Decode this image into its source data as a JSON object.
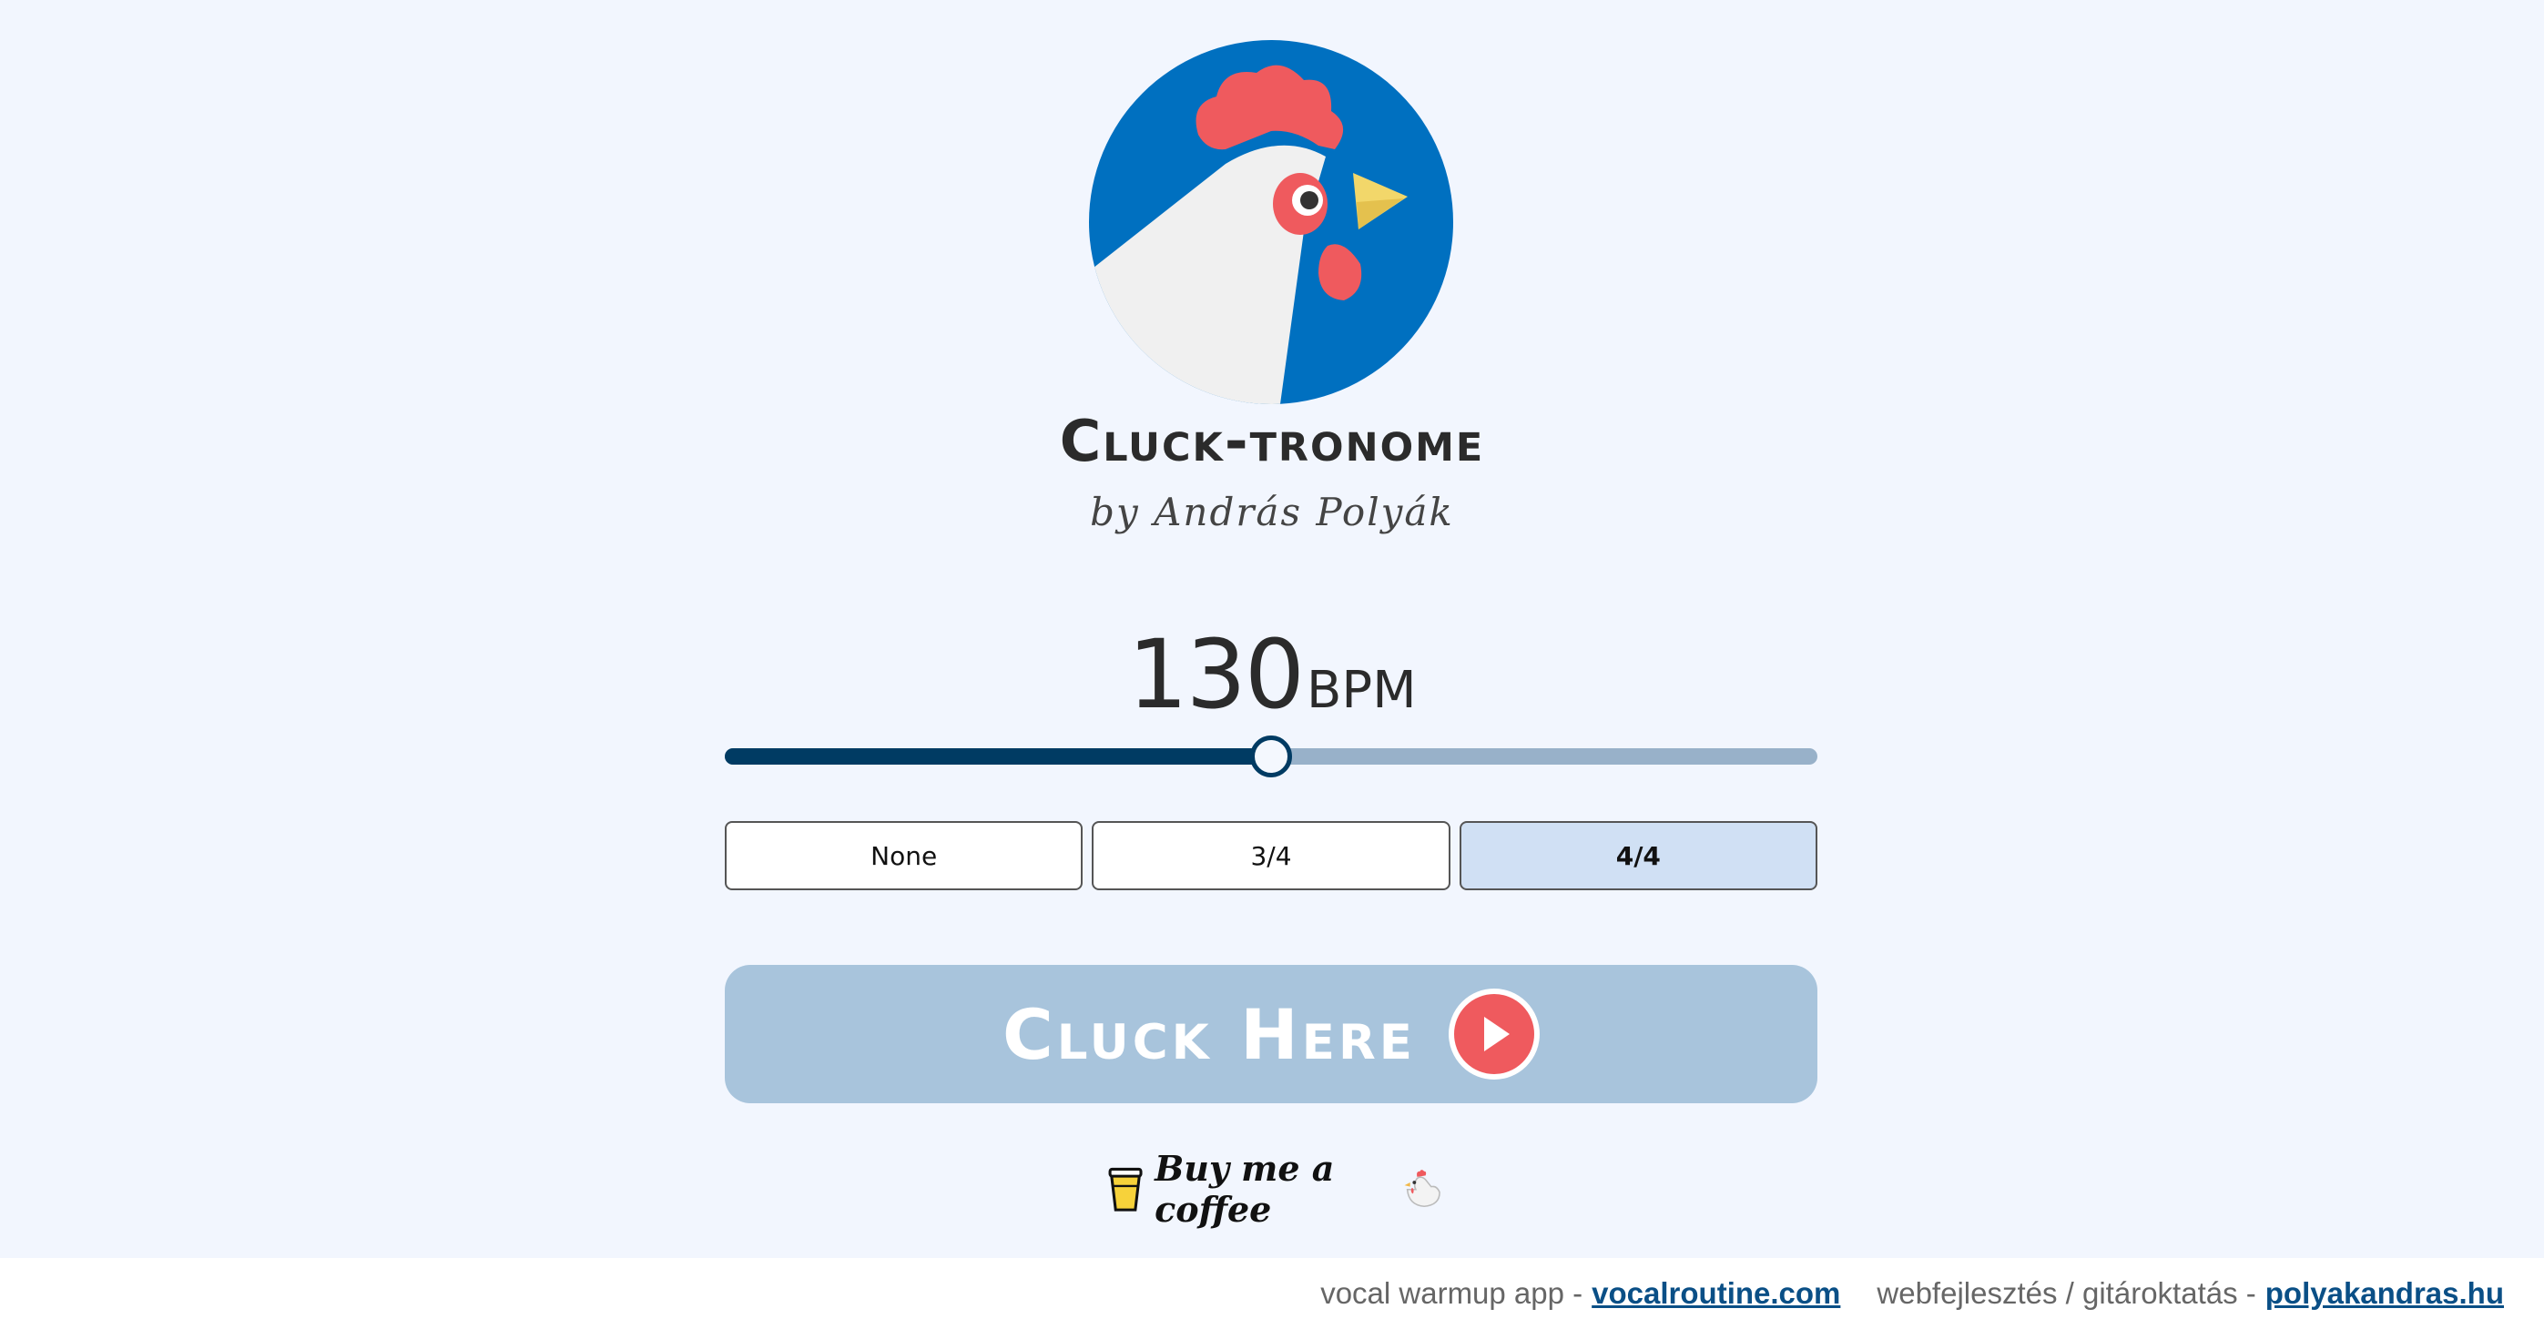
{
  "app": {
    "title": "Cluck-tronome",
    "subtitle": "by András Polyák"
  },
  "tempo": {
    "value": "130",
    "unit": "BPM",
    "slider_fraction": 0.5
  },
  "time_signatures": {
    "options": [
      "None",
      "3/4",
      "4/4"
    ],
    "selected": "4/4"
  },
  "cluck_button": {
    "label": "Cluck Here"
  },
  "coffee": {
    "label": "Buy me a coffee"
  },
  "footer": {
    "item1_text": "vocal warmup app -",
    "item1_link": "vocalroutine.com",
    "item2_text": "webfejlesztés / gitároktatás -",
    "item2_link": "polyakandras.hu"
  },
  "colors": {
    "background": "#f2f6fe",
    "logo_blue": "#0070c0",
    "accent_red": "#ef5a5e",
    "slider_dark": "#003b63",
    "slider_light": "#98b1c9",
    "button_bg": "#a8c4dc",
    "selected_bg": "#d0e0f4"
  },
  "icons": {
    "logo": "rooster-logo-icon",
    "play": "play-icon",
    "coffee_cup": "coffee-cup-icon",
    "chicken": "chicken-icon"
  }
}
